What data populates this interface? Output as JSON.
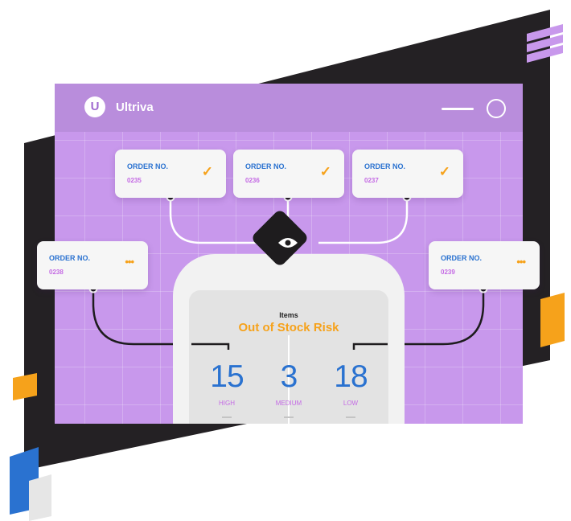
{
  "app": {
    "brand": "Ultriva",
    "logo_letter": "U"
  },
  "orders": [
    {
      "label": "ORDER NO.",
      "number": "0235",
      "status": "check"
    },
    {
      "label": "ORDER NO.",
      "number": "0236",
      "status": "check"
    },
    {
      "label": "ORDER NO.",
      "number": "0237",
      "status": "check"
    },
    {
      "label": "ORDER NO.",
      "number": "0238",
      "status": "pending"
    },
    {
      "label": "ORDER NO.",
      "number": "0239",
      "status": "pending"
    }
  ],
  "summary": {
    "title": "Items",
    "subtitle": "Out of Stock Risk",
    "stats": [
      {
        "value": "15",
        "label": "HIGH"
      },
      {
        "value": "3",
        "label": "MEDIUM"
      },
      {
        "value": "18",
        "label": "LOW"
      }
    ]
  },
  "icons": {
    "check": "✓",
    "more": "•••",
    "eye": "eye-icon"
  },
  "colors": {
    "purple": "#c898ec",
    "dark": "#1e1c1e",
    "blue": "#2a72d0",
    "orange": "#f6a21b",
    "pink": "#c46ae4"
  }
}
